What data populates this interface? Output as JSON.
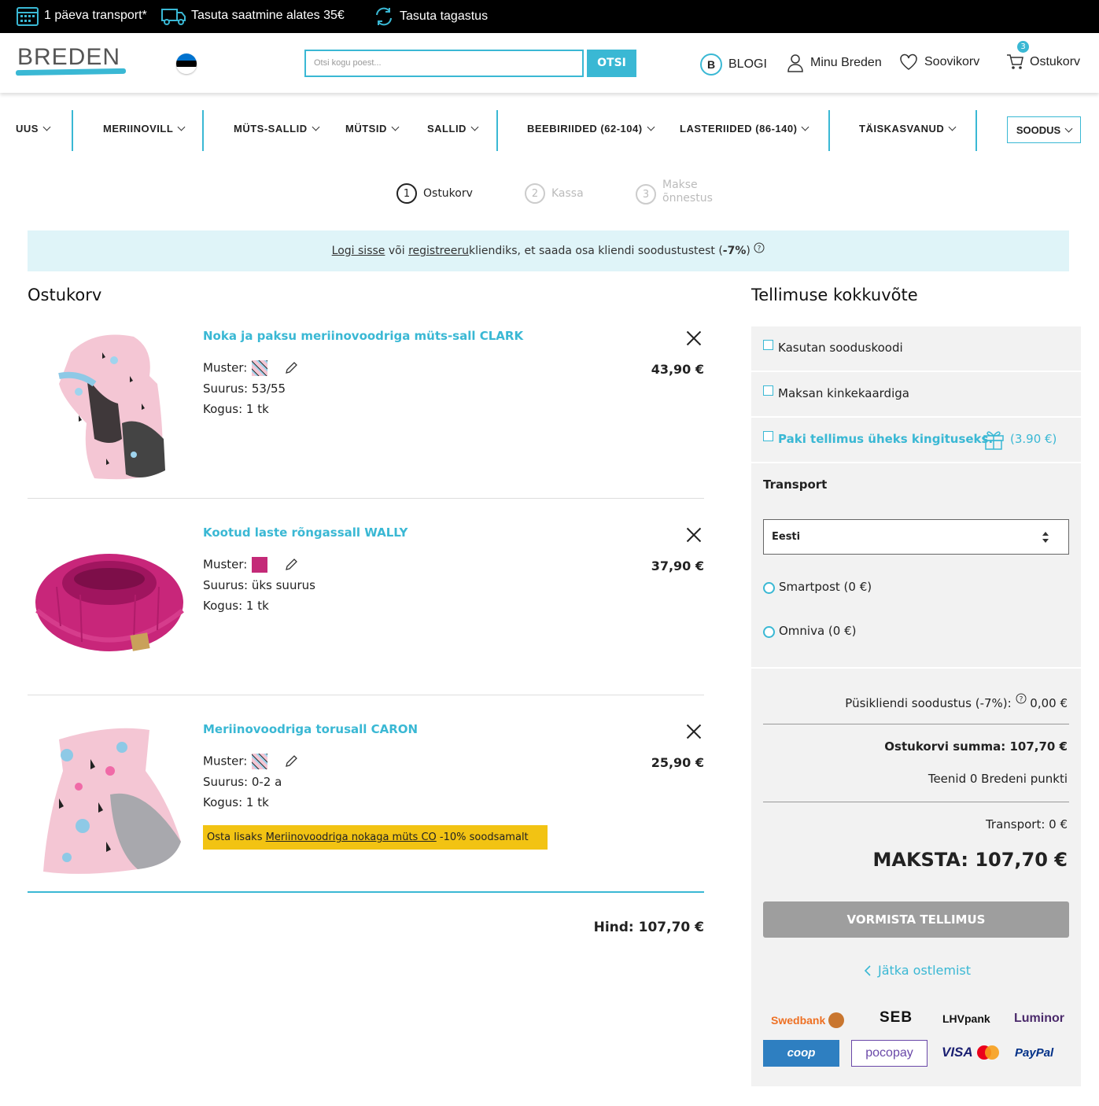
{
  "topbar": {
    "transport": "1 päeva transport*",
    "shipping": "Tasuta saatmine alates 35€",
    "returns": "Tasuta tagastus"
  },
  "header": {
    "logo": "BREDEN",
    "search_placeholder": "Otsi kogu poest...",
    "search_button": "OTSI",
    "blog": "BLOGI",
    "blog_letter": "B",
    "account": "Minu Breden",
    "wishlist": "Soovikorv",
    "cart": "Ostukorv",
    "cart_count": "3"
  },
  "nav": {
    "items": [
      "UUS",
      "MERIINOVILL",
      "MÜTS-SALLID",
      "MÜTSID",
      "SALLID",
      "BEEBIRIIDED (62-104)",
      "LASTERIIDED (86-140)",
      "TÄISKASVANUD",
      "SOODUS"
    ]
  },
  "steps": [
    {
      "num": "1",
      "label": "Ostukorv"
    },
    {
      "num": "2",
      "label": "Kassa"
    },
    {
      "num": "3",
      "label": "Makse õnnestus"
    }
  ],
  "banner": {
    "login": "Logi sisse",
    "or": "või",
    "register": "registreeru",
    "rest": "kliendiks, et saada osa kliendi soodustustest (",
    "discount": "-7%",
    "close": ")"
  },
  "cart": {
    "title": "Ostukorv",
    "items": [
      {
        "name": "Noka ja paksu meriinovoodriga müts-sall CLARK",
        "pattern_label": "Muster:",
        "size": "Suurus: 53/55",
        "qty": "Kogus: 1 tk",
        "price": "43,90 €"
      },
      {
        "name": "Kootud laste rõngassall WALLY",
        "pattern_label": "Muster:",
        "size": "Suurus: üks suurus",
        "qty": "Kogus: 1 tk",
        "price": "37,90 €"
      },
      {
        "name": "Meriinovoodriga torusall CARON",
        "pattern_label": "Muster:",
        "size": "Suurus: 0-2 a",
        "qty": "Kogus: 1 tk",
        "price": "25,90 €"
      }
    ],
    "promo_prefix": "Osta lisaks",
    "promo_link": "Meriinovoodriga nokaga müts CO",
    "promo_suffix": "-10% soodsamalt",
    "total": "Hind: 107,70 €"
  },
  "summary": {
    "title": "Tellimuse kokkuvõte",
    "coupon": "Kasutan sooduskoodi",
    "giftcard": "Maksan kinkekaardiga",
    "giftwrap": "Paki tellimus üheks kingituseks.",
    "giftwrap_price": "(3.90 €)",
    "transport_label": "Transport",
    "country": "Eesti",
    "smartpost": "Smartpost (0 €)",
    "omniva": "Omniva (0 €)",
    "loyal_label": "Püsikliendi soodustus (-7%):",
    "loyal_value": "0,00 €",
    "cart_sum": "Ostukorvi summa: 107,70 €",
    "points": "Teenid 0 Bredeni punkti",
    "transport_cost": "Transport: 0 €",
    "pay_total": "MAKSTA: 107,70 €",
    "confirm": "VORMISTA TELLIMUS",
    "continue": "Jätka ostlemist"
  },
  "payments": [
    "Swedbank",
    "SEB",
    "LHVpank",
    "Luminor",
    "coop",
    "pocopay",
    "VISA",
    "PayPal"
  ],
  "colors": {
    "accent": "#3ab8d4",
    "promo": "#f2c313",
    "banner": "#dff4f8"
  }
}
